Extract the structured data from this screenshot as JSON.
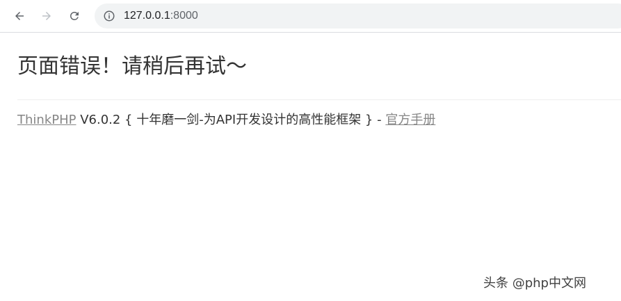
{
  "browser": {
    "url_host": "127.0.0.1",
    "url_port": ":8000",
    "back_icon": "arrow-left-icon",
    "forward_icon": "arrow-right-icon",
    "reload_icon": "reload-icon",
    "info_icon": "info-icon"
  },
  "page": {
    "title": "页面错误！请稍后再试～",
    "copyright": {
      "framework_link": "ThinkPHP",
      "version": " V6.0.2 ",
      "slogan": "{ 十年磨一剑-为API开发设计的高性能框架 }",
      "separator": " - ",
      "manual_link": "官方手册"
    }
  },
  "watermark": {
    "text": "头条 @php中文网"
  },
  "colors": {
    "toolbar_bg": "#ffffff",
    "omnibox_bg": "#f1f3f4",
    "link": "#868686",
    "text": "#333333",
    "divider": "#eeeeee"
  }
}
